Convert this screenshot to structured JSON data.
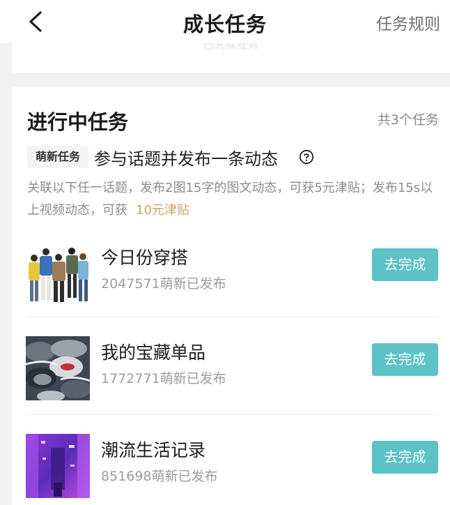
{
  "header": {
    "title": "成长任务",
    "rules_label": "任务规则",
    "back_icon": "chevron-left-icon"
  },
  "previous_section": {
    "faded_text": "已完成任务"
  },
  "section": {
    "title": "进行中任务",
    "count": "共3个任务"
  },
  "task": {
    "tag": "萌新任务",
    "name": "参与话题并发布一条动态",
    "help_icon": "question-circle-icon",
    "description": "关联以下任一话题，发布2图15字的图文动态，可获5元津贴；发布15s以上视频动态，可获",
    "reward": "10元津贴"
  },
  "topics": [
    {
      "title": "今日份穿搭",
      "stat": "2047571萌新已发布",
      "button": "去完成"
    },
    {
      "title": "我的宝藏单品",
      "stat": "1772771萌新已发布",
      "button": "去完成"
    },
    {
      "title": "潮流生活记录",
      "stat": "851698萌新已发布",
      "button": "去完成"
    }
  ],
  "colors": {
    "accent": "#5cc2c8",
    "reward": "#c8a46a",
    "background": "#f2f2f4"
  }
}
